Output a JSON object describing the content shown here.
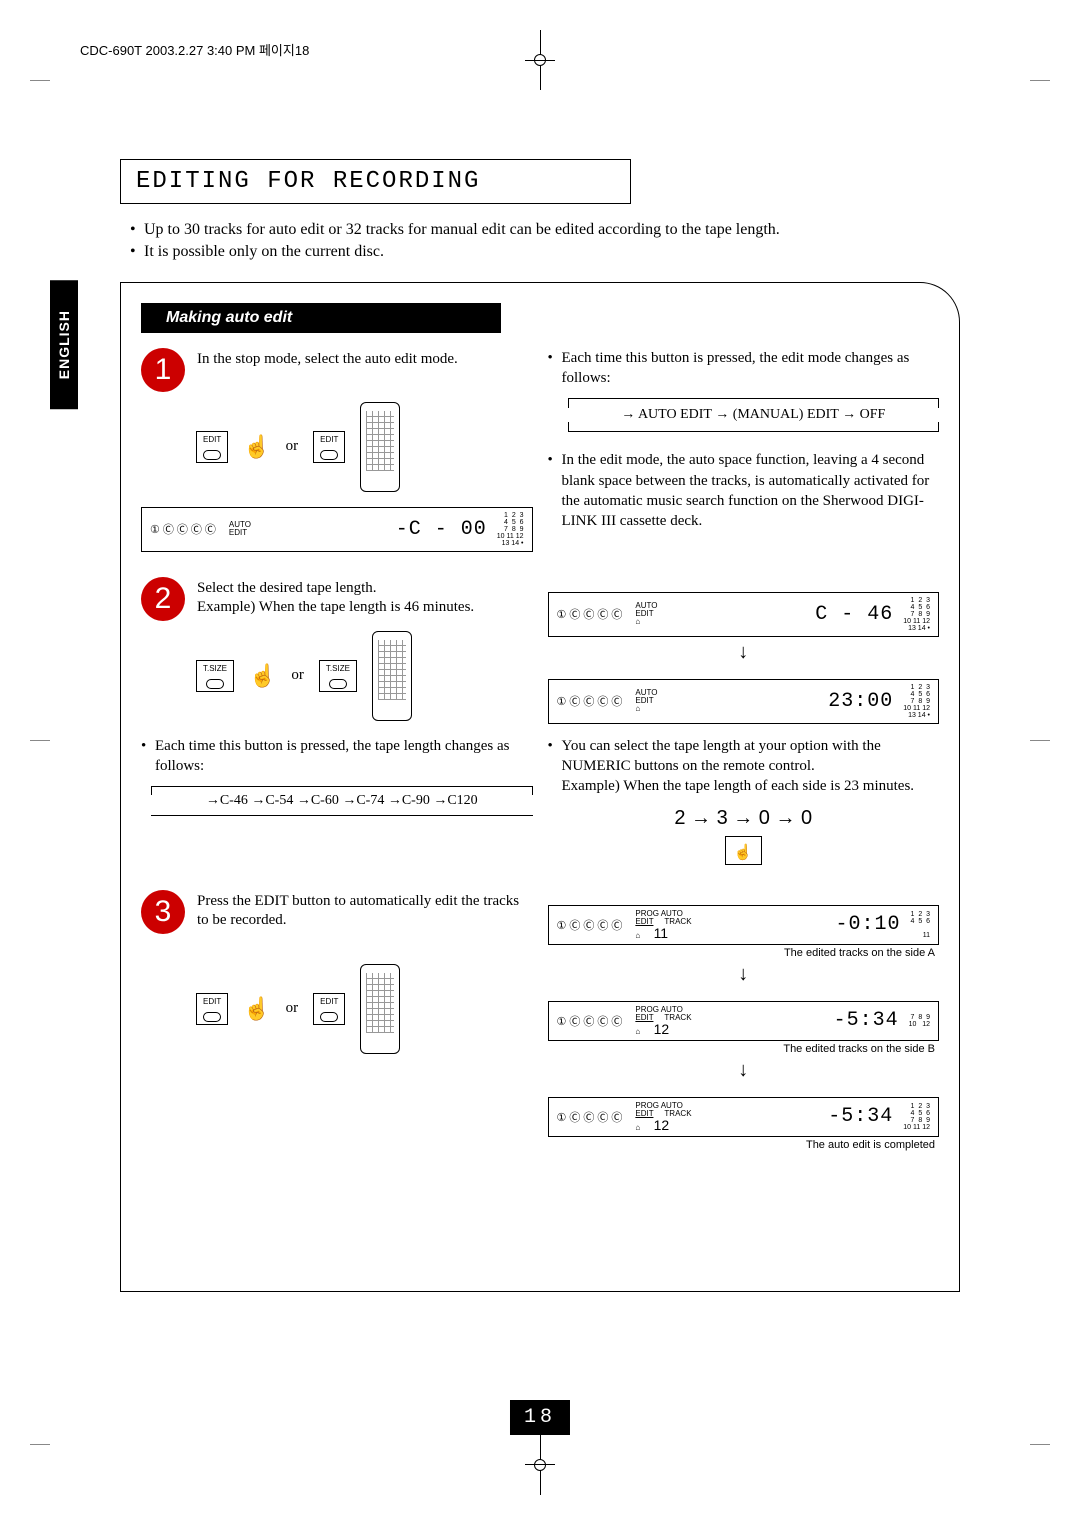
{
  "header_info": "CDC-690T  2003.2.27 3:40 PM  페이지18",
  "section_title": "EDITING FOR RECORDING",
  "intro_bullets": [
    "Up to 30 tracks for auto edit or 32 tracks for manual edit can be edited according to the tape length.",
    "It is possible only on the current disc."
  ],
  "lang_tab": "ENGLISH",
  "sub_header": "Making auto edit",
  "or_label": "or",
  "step1": {
    "num": "1",
    "text": "In the stop mode, select the auto edit mode.",
    "btn_label": "EDIT",
    "remote_btn": "EDIT",
    "lcd_discs": "①ⒸⒸⒸⒸ",
    "lcd_mid_top": "AUTO",
    "lcd_mid_bot": "EDIT",
    "lcd_big": "-C - 00",
    "lcd_nums": "1  2  3\n4  5  6\n7  8  9\n10 11 12\n13 14 •",
    "r_bullet1": "Each time this button is pressed, the edit mode changes as follows:",
    "cycle": "→ AUTO EDIT → (MANUAL) EDIT → OFF",
    "r_bullet2": "In the edit mode, the auto space function, leaving a 4 second blank space between the tracks, is automatically activated for the automatic music search function on the Sherwood DIGI-LINK III cassette deck."
  },
  "step2": {
    "num": "2",
    "text": "Select the desired tape length.\nExample) When the tape length is 46 minutes.",
    "btn_label": "T.SIZE",
    "remote_btn": "T.SIZE",
    "foot_bullet": "Each time this button is pressed, the tape length changes as follows:",
    "tape_cycle": "→C-46 →C-54 →C-60 →C-74 →C-90 →C120",
    "lcd1_discs": "①ⒸⒸⒸⒸ",
    "lcd1_big": "C - 46",
    "lcd2_discs": "①ⒸⒸⒸⒸ",
    "lcd2_big": "23:00",
    "r_bullet": "You can select the tape length at your option with the NUMERIC buttons on the remote control.\nExample) When the tape length of each side is 23 minutes.",
    "seq": "2 → 3 → 0 → 0"
  },
  "step3": {
    "num": "3",
    "text": "Press the EDIT button to automatically edit the tracks to be recorded.",
    "btn_label": "EDIT",
    "remote_btn": "EDIT",
    "lcd_a_discs": "①ⒸⒸⒸⒸ",
    "lcd_a_track": "11",
    "lcd_a_big": "-0:10",
    "cap_a": "The edited tracks on the side A",
    "lcd_b_discs": "①ⒸⒸⒸⒸ",
    "lcd_b_track": "12",
    "lcd_b_big": "-5:34",
    "cap_b": "The edited tracks on the side B",
    "lcd_c_discs": "①ⒸⒸⒸⒸ",
    "lcd_c_track": "12",
    "lcd_c_big": "-5:34",
    "cap_c": "The auto edit is completed"
  },
  "lcd_labels": {
    "auto": "AUTO",
    "edit": "EDIT",
    "prog": "PROG",
    "tape": "⌂",
    "track": "TRACK"
  },
  "page_num": "18"
}
